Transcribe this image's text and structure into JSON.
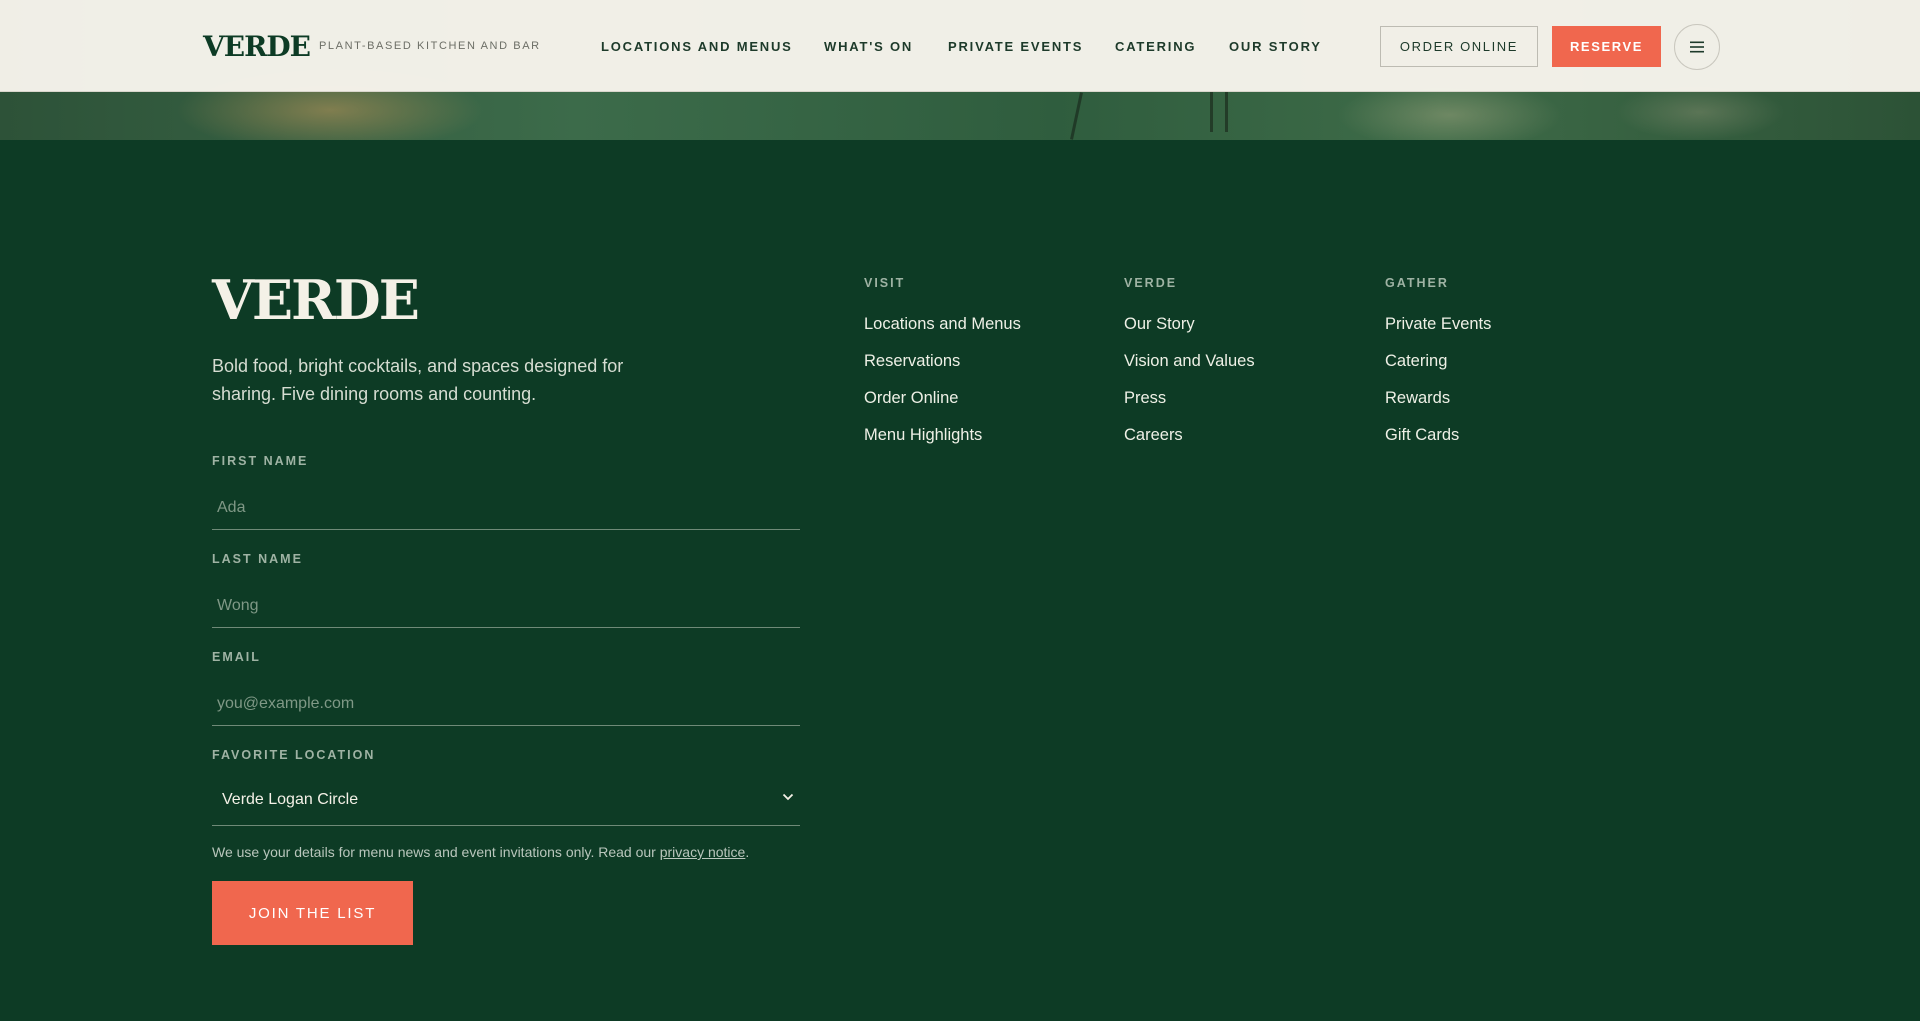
{
  "header": {
    "brand": "VERDE",
    "tagline": "PLANT-BASED KITCHEN AND BAR",
    "nav": [
      "LOCATIONS AND MENUS",
      "WHAT'S ON",
      "PRIVATE EVENTS",
      "CATERING",
      "OUR STORY"
    ],
    "order_online": "ORDER ONLINE",
    "reserve": "RESERVE",
    "menu_icon": "hamburger-icon"
  },
  "footer": {
    "logo": "VERDE",
    "description": "Bold food, bright cocktails, and spaces designed for sharing. Five dining rooms and counting.",
    "form": {
      "first_name_label": "FIRST NAME",
      "first_name_placeholder": "Ada",
      "last_name_label": "LAST NAME",
      "last_name_placeholder": "Wong",
      "email_label": "EMAIL",
      "email_placeholder": "you@example.com",
      "location_label": "FAVORITE LOCATION",
      "location_value": "Verde Logan Circle",
      "privacy_prefix": "We use your details for menu news and event invitations only. Read our ",
      "privacy_link": "privacy notice",
      "privacy_suffix": ".",
      "submit": "JOIN THE LIST"
    },
    "columns": [
      {
        "heading": "VISIT",
        "links": [
          "Locations and Menus",
          "Reservations",
          "Order Online",
          "Menu Highlights"
        ]
      },
      {
        "heading": "VERDE",
        "links": [
          "Our Story",
          "Vision and Values",
          "Press",
          "Careers"
        ]
      },
      {
        "heading": "GATHER",
        "links": [
          "Private Events",
          "Catering",
          "Rewards",
          "Gift Cards"
        ]
      }
    ]
  },
  "colors": {
    "accent": "#f0674e",
    "footer_bg": "#0d3b25",
    "header_bg": "#f7f4ec"
  }
}
